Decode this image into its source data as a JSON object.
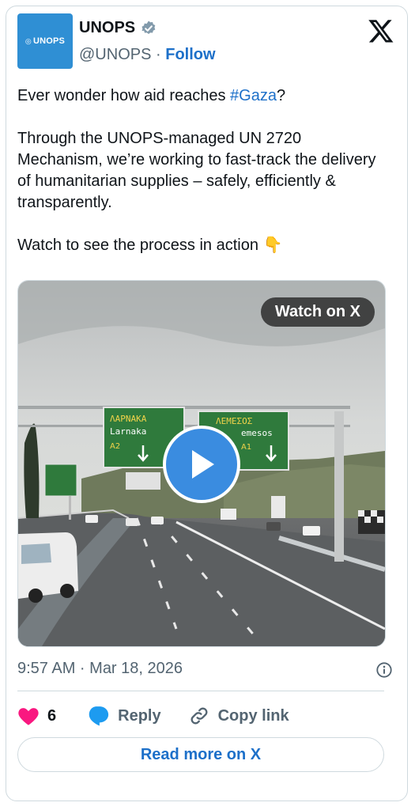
{
  "author": {
    "name": "UNOPS",
    "handle": "@UNOPS",
    "separator": "·",
    "follow_label": "Follow",
    "avatar_text": "UNOPS",
    "verified_icon": "verified-badge-icon"
  },
  "tweet": {
    "line1_pre": "Ever wonder how aid reaches ",
    "hashtag": "#Gaza",
    "line1_post": "?",
    "paragraph2": "Through the UNOPS-managed UN 2720 Mechanism, we’re working to fast-track the delivery of humanitarian supplies – safely, efficiently & transparently.",
    "paragraph3": "Watch to see the process in action",
    "emoji": "👇"
  },
  "media": {
    "watch_label": "Watch on X",
    "signs": {
      "left_greek": "ΛΑΡΝΑΚΑ",
      "left_latin": "Larnaka",
      "left_route": "A2",
      "right_greek": "ΛΕΜΕΣΟΣ",
      "right_latin": "emesos",
      "right_route": "A1"
    }
  },
  "meta": {
    "timestamp": "9:57 AM · Mar 18, 2026"
  },
  "actions": {
    "like_count": "6",
    "reply_label": "Reply",
    "copy_label": "Copy link"
  },
  "footer": {
    "read_more_label": "Read more on X"
  },
  "colors": {
    "link": "#1d70c9",
    "like_heart": "#f91880",
    "reply_bubble": "#1d9bf0",
    "play_button": "#3a8ce0"
  }
}
